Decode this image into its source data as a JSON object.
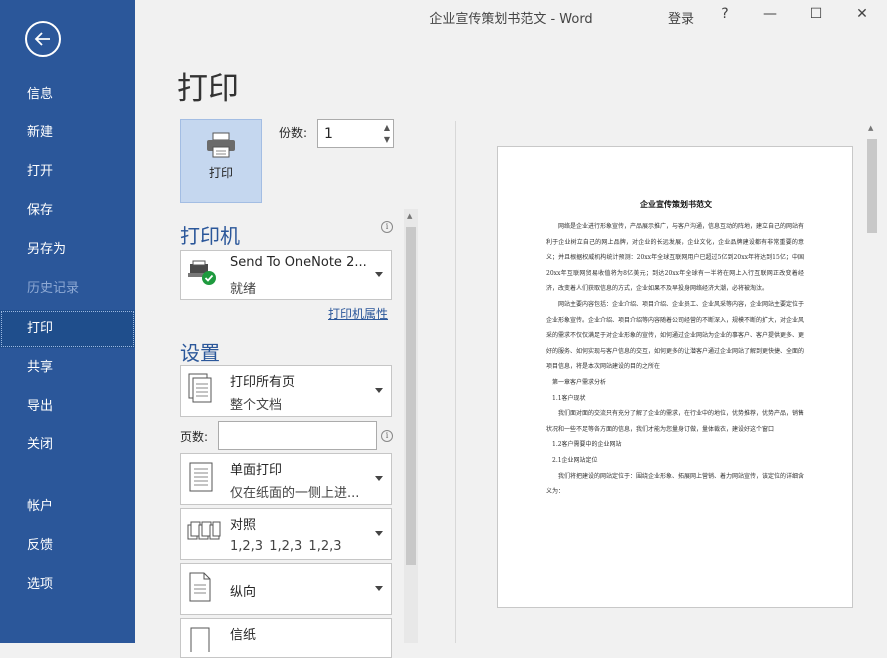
{
  "window": {
    "title": "企业宣传策划书范文  -  Word",
    "login": "登录",
    "help": "?",
    "minimize": "—",
    "maximize": "☐",
    "close": "✕"
  },
  "sidebar": {
    "items": [
      {
        "label": "信息"
      },
      {
        "label": "新建"
      },
      {
        "label": "打开"
      },
      {
        "label": "保存"
      },
      {
        "label": "另存为"
      },
      {
        "label": "历史记录"
      },
      {
        "label": "打印"
      },
      {
        "label": "共享"
      },
      {
        "label": "导出"
      },
      {
        "label": "关闭"
      },
      {
        "label": "帐户"
      },
      {
        "label": "反馈"
      },
      {
        "label": "选项"
      }
    ]
  },
  "print": {
    "title": "打印",
    "button_label": "打印",
    "copies_label": "份数:",
    "copies_value": "1",
    "printer_heading": "打印机",
    "printer_name": "Send To OneNote 2...",
    "printer_status": "就绪",
    "printer_props": "打印机属性",
    "settings_heading": "设置",
    "pages_label": "页数:",
    "settings": [
      {
        "line1": "打印所有页",
        "line2": "整个文档"
      },
      {
        "line1": "单面打印",
        "line2": "仅在纸面的一侧上进..."
      },
      {
        "line1": "对照",
        "line2": "1,2,3     1,2,3     1,2,3"
      },
      {
        "line1": "纵向",
        "line2": ""
      },
      {
        "line1": "信纸",
        "line2": ""
      }
    ]
  },
  "preview": {
    "title": "企业宣传策划书范文",
    "paragraphs": [
      {
        "text": "网络是企业进行形象宣传，产品展示推广，与客户沟通，信息互动的阵地，建立自己的网站有利于企业树立自己的网上品牌，对企业的长远发展，企业文化，企业品牌建设都有非常重要的意义；并且根据权威机构统计预测：20xx年全球互联网用户已超过5亿到20xx年将达到15亿；中国20xx年互联网贸易收值将为8亿美元；到达20xx年全球有一半将在网上入行互联网正改变着经济，改变着人们获取信息的方式，企业如果不及早投身网络经济大潮，必将被淘汰。",
        "h": false
      },
      {
        "text": "网站主要内容包括：企业介绍、项目介绍、企业员工、企业风采等内容，企业网站主要定位于企业形象宣传。企业介绍、项目介绍等内容随着公司经营的不断深入，规模不断的扩大，对企业风采的需求不仅仅满足于对企业形象的宣传，如何通过企业网站为企业的事客户、客户提供更多、更好的服务、如何实现与客户信息的交互，如何更多的让潜客户通过企业网站了解到更快捷、全面的项目信息，将是本次网站建设的目的之所在",
        "h": false
      },
      {
        "text": "第一章客户需求分析",
        "h": true
      },
      {
        "text": "1.1客户现状",
        "h": true
      },
      {
        "text": "我们面对面的交流只有充分了解了企业的需求，在行业中的地位，优势推荐，优势产品，销售状况和一些不足等各方面的信息，我们才能为您量身订做，量体裁衣，建设好这个窗口",
        "h": false
      },
      {
        "text": "1.2客户需要中的企业网站",
        "h": true
      },
      {
        "text": "2.1企业网站定位",
        "h": true
      },
      {
        "text": "我们将把建设的网站定位于：围绕企业形象、拓展网上营销、着力网站宣传，该定位的详细含义为：",
        "h": false
      }
    ]
  },
  "colors": {
    "sidebar": "#2b579a",
    "accent": "#2b579a",
    "print_button": "#c5d7ef"
  }
}
